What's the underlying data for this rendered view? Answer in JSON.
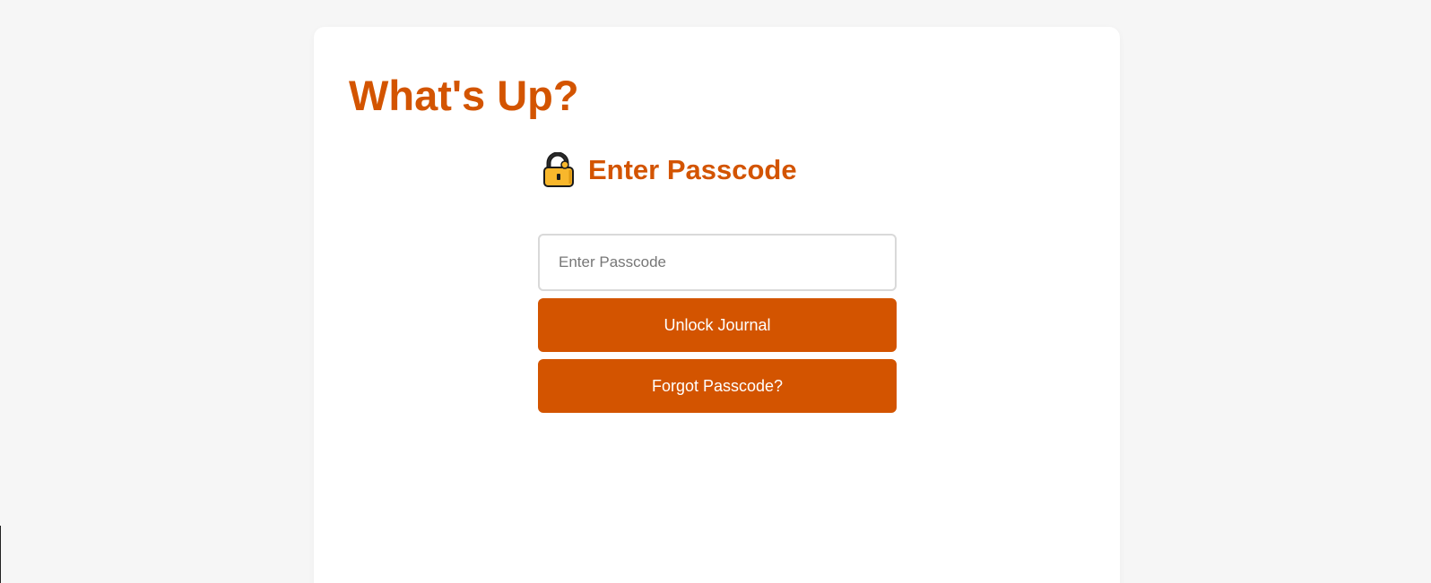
{
  "app": {
    "title": "What's Up?"
  },
  "lock_screen": {
    "icon": "lock-icon",
    "heading": "Enter Passcode",
    "passcode_input": {
      "placeholder": "Enter Passcode",
      "value": ""
    },
    "unlock_button_label": "Unlock Journal",
    "forgot_button_label": "Forgot Passcode?"
  },
  "colors": {
    "accent": "#d35400",
    "background": "#f6f6f6",
    "card": "#ffffff",
    "input_border": "#d9d9d9"
  }
}
